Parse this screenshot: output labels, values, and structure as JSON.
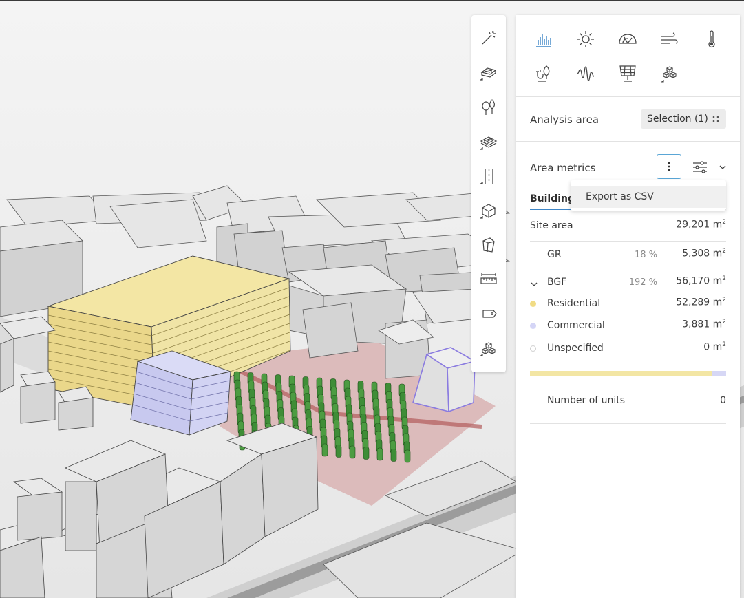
{
  "toolbar": {
    "tools": [
      {
        "name": "magic-wand-icon"
      },
      {
        "name": "building-generate-icon"
      },
      {
        "name": "trees-icon"
      },
      {
        "name": "surface-icon"
      },
      {
        "name": "road-icon"
      },
      {
        "name": "box-icon"
      },
      {
        "name": "polygon-block-icon"
      },
      {
        "name": "measure-icon"
      },
      {
        "name": "tag-icon"
      },
      {
        "name": "cubes-icon"
      }
    ]
  },
  "panel": {
    "analysis_icons": [
      {
        "name": "bar-chart-icon",
        "active": true
      },
      {
        "name": "sun-icon"
      },
      {
        "name": "noise-dome-icon"
      },
      {
        "name": "wind-icon"
      },
      {
        "name": "thermometer-icon"
      },
      {
        "name": "plant-energy-icon"
      },
      {
        "name": "sound-wave-icon"
      },
      {
        "name": "solar-panel-icon"
      },
      {
        "name": "cubes-analysis-icon"
      }
    ],
    "analysis_area": {
      "label": "Analysis area",
      "selection": "Selection (1)"
    },
    "area_metrics": {
      "label": "Area metrics",
      "menu_item": "Export as CSV",
      "tab": "Buildings",
      "site_area": {
        "label": "Site area",
        "value": "29,201 m",
        "unit_sup": "2"
      },
      "gr": {
        "label": "GR",
        "pct": "18 %",
        "value": "5,308 m",
        "unit_sup": "2"
      },
      "bgf": {
        "label": "BGF",
        "pct": "192 %",
        "value": "56,170 m",
        "unit_sup": "2"
      },
      "residential": {
        "label": "Residential",
        "value": "52,289 m",
        "unit_sup": "2",
        "color": "#f1dc85"
      },
      "commercial": {
        "label": "Commercial",
        "value": "3,881 m",
        "unit_sup": "2",
        "color": "#d4d5f6"
      },
      "unspecified": {
        "label": "Unspecified",
        "value": "0 m",
        "unit_sup": "2"
      },
      "units": {
        "label": "Number of units",
        "value": "0"
      },
      "bar_share": {
        "residential": 0.93,
        "commercial": 0.07
      }
    }
  },
  "colors": {
    "accent": "#3d85c6",
    "residential": "#efdf96",
    "commercial": "#cfd0f2",
    "site": "#d8b8b8",
    "trees": "#3c8a35"
  }
}
